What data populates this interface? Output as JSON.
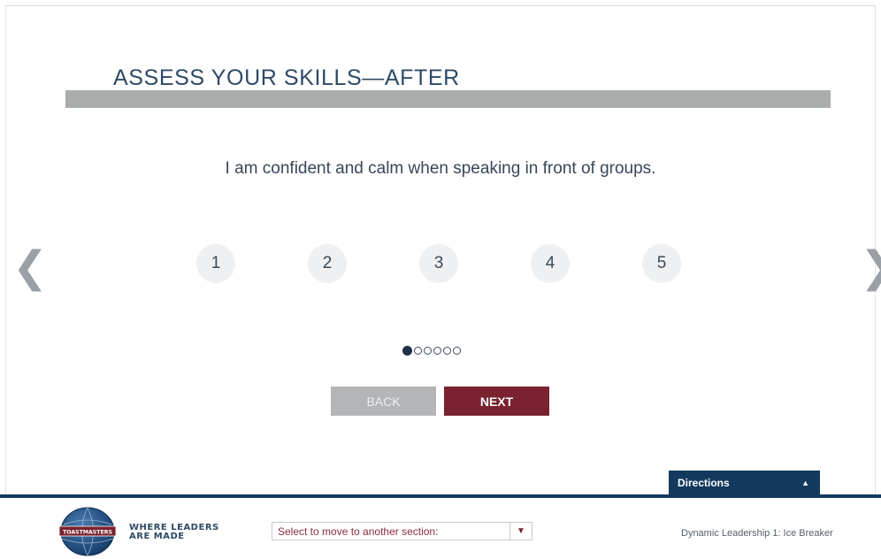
{
  "title": "ASSESS YOUR SKILLS—AFTER",
  "question": "I am confident and calm when speaking in front of groups.",
  "nav": {
    "prev_icon": "❮",
    "next_icon": "❯"
  },
  "ratings": [
    "1",
    "2",
    "3",
    "4",
    "5"
  ],
  "progress": {
    "current": 1,
    "total": 6
  },
  "buttons": {
    "back": "BACK",
    "next": "NEXT"
  },
  "directions": {
    "label": "Directions",
    "icon": "▲"
  },
  "footer": {
    "tagline_line1": "WHERE LEADERS",
    "tagline_line2": "ARE MADE",
    "logo_text": "TOASTMASTERS",
    "section_select": "Select to move to another section:",
    "select_icon": "▼",
    "course": "Dynamic Leadership 1: Ice Breaker"
  },
  "colors": {
    "title": "#2e4a66",
    "title_bar": "#a9aeac",
    "next_button": "#7a2230",
    "back_button": "#b3b5b7",
    "navy": "#133a5e"
  }
}
